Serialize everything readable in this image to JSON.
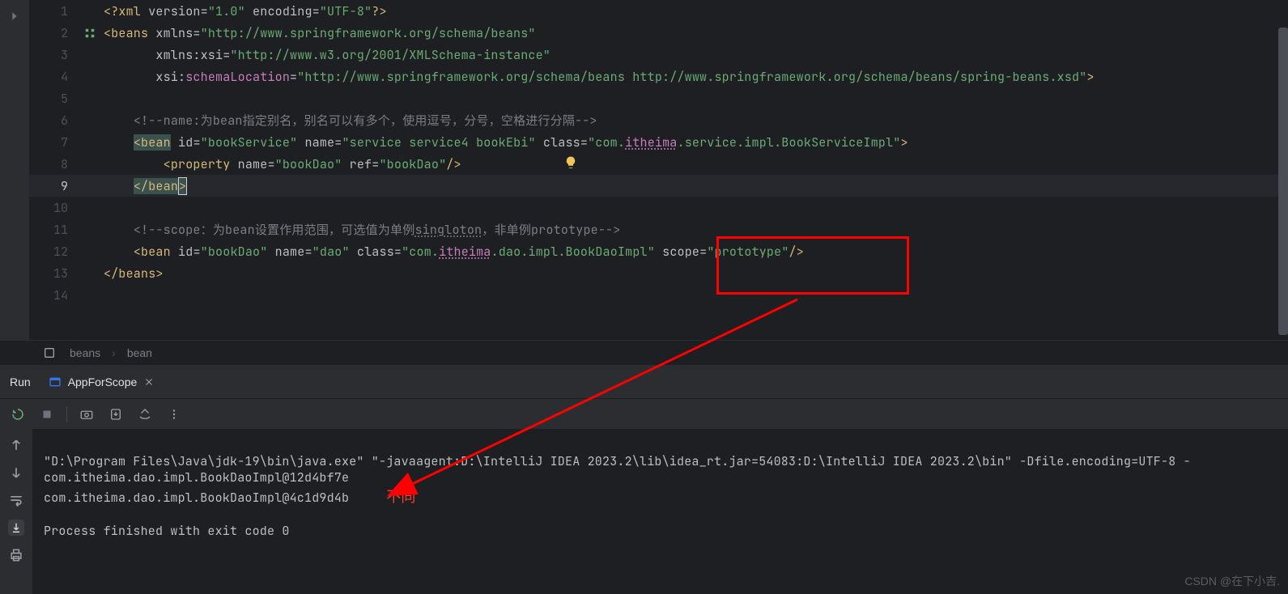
{
  "editor": {
    "lines": {
      "l1": {
        "n": "1"
      },
      "l2": {
        "n": "2"
      },
      "l3": {
        "n": "3"
      },
      "l4": {
        "n": "4"
      },
      "l5": {
        "n": "5"
      },
      "l6": {
        "n": "6"
      },
      "l7": {
        "n": "7"
      },
      "l8": {
        "n": "8"
      },
      "l9": {
        "n": "9"
      },
      "l10": {
        "n": "10"
      },
      "l11": {
        "n": "11"
      },
      "l12": {
        "n": "12"
      },
      "l13": {
        "n": "13"
      },
      "l14": {
        "n": "14"
      }
    },
    "xml_pi_open": "<?",
    "xml_pi_name": "xml ",
    "xml_pi_attrs": "version",
    "xml_pi_eq": "=",
    "xml_pi_v1": "\"1.0\"",
    "xml_pi_enc": " encoding",
    "xml_pi_v2": "\"UTF-8\"",
    "xml_pi_close": "?>",
    "beans_open_lt": "<",
    "beans_tag": "beans",
    "beans_xmlns_k": " xmlns",
    "beans_xmlns_v": "\"http://www.springframework.org/schema/beans\"",
    "xmlns_xsi_k": "       xmlns:xsi",
    "xmlns_xsi_v": "\"http://www.w3.org/2001/XMLSchema-instance\"",
    "xsi_loc_k": "       xsi",
    "xsi_loc_colon": ":",
    "xsi_loc_name": "schemaLocation",
    "xsi_loc_v": "\"http://www.springframework.org/schema/beans http://www.springframework.org/schema/beans/spring-beans.xsd\"",
    "gt": ">",
    "comment1_open": "<!--",
    "comment1_text": "name:为bean指定别名，别名可以有多个，使用逗号，分号，空格进行分隔",
    "comment_close": "-->",
    "bean1_lt": "<",
    "bean1_tag": "bean",
    "bean1_id_k": " id",
    "bean1_id_v": "\"bookService\"",
    "bean1_name_k": " name",
    "bean1_name_v": "\"service service4 bookEbi\"",
    "bean1_class_k": " class",
    "bean1_class_v1": "\"com.",
    "bean1_class_pkg": "itheima",
    "bean1_class_v2": ".service.impl.BookServiceImpl\"",
    "prop_lt": "<",
    "prop_tag": "property",
    "prop_name_k": " name",
    "prop_name_v": "\"bookDao\"",
    "prop_ref_k": " ref",
    "prop_ref_v": "\"bookDao\"",
    "prop_close": "/>",
    "bean1_close_lt": "</",
    "bean1_close_tag": "bean",
    "comment2_open": "<!--",
    "comment2_text1": "scope：为bean设置作用范围，可选值为单例",
    "comment2_singloton": "singloton",
    "comment2_text2": "，非单例prototype",
    "bean2_lt": "<",
    "bean2_tag": "bean",
    "bean2_id_k": " id",
    "bean2_id_v": "\"bookDao\"",
    "bean2_name_k": " name",
    "bean2_name_v": "\"dao\"",
    "bean2_class_k": " class",
    "bean2_class_v1": "\"com.",
    "bean2_class_pkg": "itheima",
    "bean2_class_v2": ".dao.impl.BookDaoImpl\"",
    "bean2_scope_k": " scope",
    "bean2_scope_v": "\"prototype\"",
    "bean2_close": "/>",
    "beans_close_lt": "</",
    "beans_close_tag": "beans",
    "indent1": "    ",
    "indent2": "        ",
    "eq": "="
  },
  "breadcrumb": {
    "b1": "beans",
    "sep": "›",
    "b2": "bean"
  },
  "run": {
    "label": "Run",
    "tab": "AppForScope"
  },
  "console": {
    "line1": "\"D:\\Program Files\\Java\\jdk-19\\bin\\java.exe\" \"-javaagent:D:\\IntelliJ IDEA 2023.2\\lib\\idea_rt.jar=54083:D:\\IntelliJ IDEA 2023.2\\bin\" -Dfile.encoding=UTF-8 -",
    "line2": "com.itheima.dao.impl.BookDaoImpl@12d4bf7e",
    "line3": "com.itheima.dao.impl.BookDaoImpl@4c1d9d4b",
    "line4": "",
    "line5": "Process finished with exit code 0"
  },
  "annotation": {
    "red_note": "不同"
  },
  "watermark": "CSDN @在下小吉."
}
